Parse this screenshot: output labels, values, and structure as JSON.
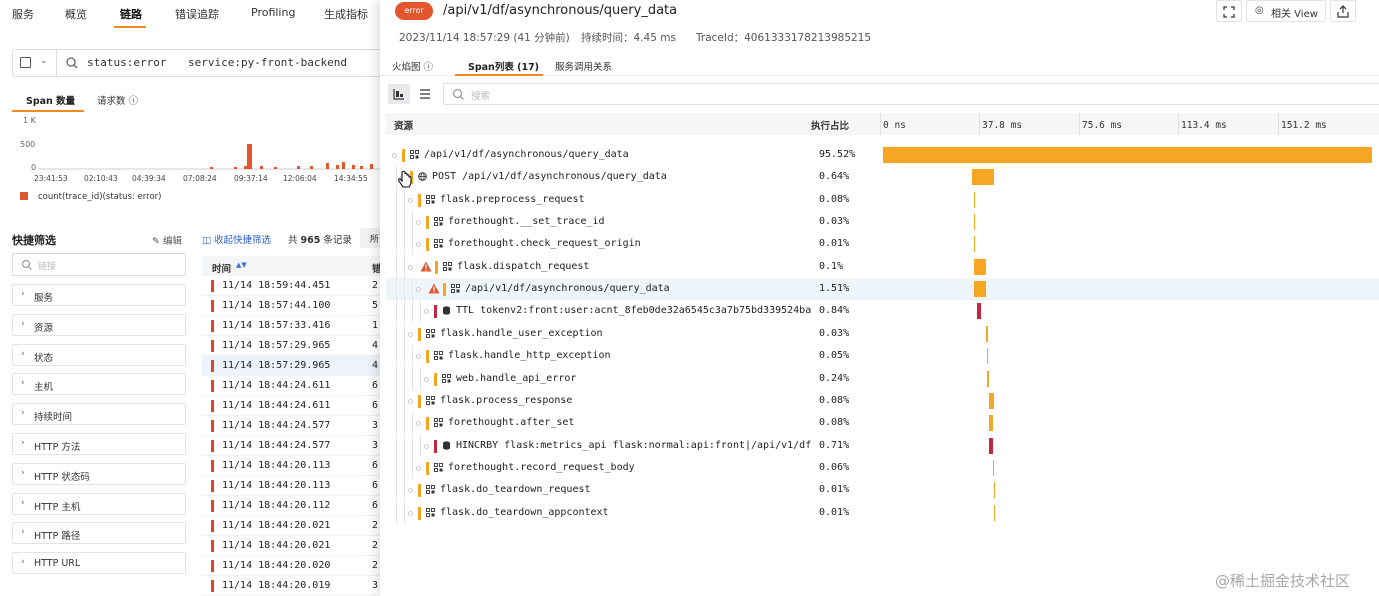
{
  "colors": {
    "accent": "#f08a24",
    "error": "#e4572e",
    "span_bar": "#f5a623",
    "db_bar": "#c0283e",
    "link": "#2f62c8"
  },
  "topnav": {
    "tabs": [
      "服务",
      "概览",
      "链路",
      "错误追踪",
      "Profiling",
      "生成指标"
    ],
    "active": "链路"
  },
  "search": {
    "tokens": [
      {
        "key": "status",
        "value": "error"
      },
      {
        "key": "service",
        "value": "py-front-backend"
      }
    ]
  },
  "chart_tabs": [
    "Span 数量",
    "请求数"
  ],
  "mini_chart": {
    "type": "bar",
    "y_ticks": [
      "1 K",
      "500",
      "0"
    ],
    "x_ticks": [
      "23:41:53",
      "02:10:43",
      "04:39:34",
      "07:08:24",
      "09:37:14",
      "12:06:04",
      "14:34:55"
    ],
    "legend": "count(trace_id)(status: error)"
  },
  "quick_filter": {
    "title": "快捷筛选",
    "edit_label": "编辑",
    "search_placeholder": "链接",
    "items": [
      "服务",
      "资源",
      "状态",
      "主机",
      "持续时间",
      "HTTP 方法",
      "HTTP 状态码",
      "HTTP 主机",
      "HTTP 路径",
      "HTTP URL"
    ]
  },
  "list_toolbar": {
    "collapse_label": "收起快捷筛选",
    "count_prefix": "共",
    "count": "965",
    "count_suffix": "条记录",
    "stub": "所"
  },
  "table": {
    "headers": [
      "时间",
      "错"
    ],
    "rows": [
      {
        "time": "11/14 18:59:44.451",
        "c": "2"
      },
      {
        "time": "11/14 18:57:44.100",
        "c": "5"
      },
      {
        "time": "11/14 18:57:33.416",
        "c": "1"
      },
      {
        "time": "11/14 18:57:29.965",
        "c": "4"
      },
      {
        "time": "11/14 18:57:29.965",
        "c": "4"
      },
      {
        "time": "11/14 18:44:24.611",
        "c": "6"
      },
      {
        "time": "11/14 18:44:24.611",
        "c": "6"
      },
      {
        "time": "11/14 18:44:24.577",
        "c": "3"
      },
      {
        "time": "11/14 18:44:24.577",
        "c": "3"
      },
      {
        "time": "11/14 18:44:20.113",
        "c": "6"
      },
      {
        "time": "11/14 18:44:20.113",
        "c": "6"
      },
      {
        "time": "11/14 18:44:20.112",
        "c": "6"
      },
      {
        "time": "11/14 18:44:20.021",
        "c": "2"
      },
      {
        "time": "11/14 18:44:20.021",
        "c": "2"
      },
      {
        "time": "11/14 18:44:20.020",
        "c": "2"
      },
      {
        "time": "11/14 18:44:20.019",
        "c": "3"
      }
    ],
    "selected_index": 4
  },
  "drawer": {
    "status_badge": "error",
    "title": "/api/v1/df/asynchronous/query_data",
    "timestamp": "2023/11/14 18:57:29 (41 分钟前)",
    "duration": "持续时间：4.45 ms",
    "trace_id": "TraceId：4061333178213985215",
    "related_view": "相关 View",
    "tabs": [
      "火焰图",
      "Span列表 (17)",
      "服务调用关系"
    ],
    "active_tab": "Span列表 (17)",
    "search_placeholder": "搜索",
    "columns": {
      "resource": "资源",
      "percent": "执行占比"
    },
    "timeline_ticks": [
      "0 ns",
      "37.8 ms",
      "75.6 ms",
      "113.4 ms",
      "151.2 ms"
    ]
  },
  "spans": [
    {
      "name": "/api/v1/df/asynchronous/query_data",
      "percent": "95.52%",
      "depth": 0,
      "kind": "web",
      "error": false
    },
    {
      "name": "POST /api/v1/df/asynchronous/query_data",
      "percent": "0.64%",
      "depth": 1,
      "kind": "http",
      "error": false
    },
    {
      "name": "flask.preprocess_request",
      "percent": "0.08%",
      "depth": 2,
      "kind": "web",
      "error": false
    },
    {
      "name": "forethought.__set_trace_id",
      "percent": "0.03%",
      "depth": 3,
      "kind": "web",
      "error": false
    },
    {
      "name": "forethought.check_request_origin",
      "percent": "0.01%",
      "depth": 3,
      "kind": "web",
      "error": false
    },
    {
      "name": "flask.dispatch_request",
      "percent": "0.1%",
      "depth": 2,
      "kind": "web",
      "error": true
    },
    {
      "name": "/api/v1/df/asynchronous/query_data",
      "percent": "1.51%",
      "depth": 3,
      "kind": "web",
      "error": true
    },
    {
      "name": "TTL tokenv2:front:user:acnt_8feb0de32a6545c3a7b75bd339524bad:…",
      "percent": "0.84%",
      "depth": 4,
      "kind": "db",
      "error": false
    },
    {
      "name": "flask.handle_user_exception",
      "percent": "0.03%",
      "depth": 2,
      "kind": "web",
      "error": false
    },
    {
      "name": "flask.handle_http_exception",
      "percent": "0.05%",
      "depth": 3,
      "kind": "web",
      "error": false
    },
    {
      "name": "web.handle_api_error",
      "percent": "0.24%",
      "depth": 4,
      "kind": "web",
      "error": false
    },
    {
      "name": "flask.process_response",
      "percent": "0.08%",
      "depth": 2,
      "kind": "web",
      "error": false
    },
    {
      "name": "forethought.after_set",
      "percent": "0.08%",
      "depth": 3,
      "kind": "web",
      "error": false
    },
    {
      "name": "HINCRBY flask:metrics_api flask:normal:api:front|/api/v1/df/a…",
      "percent": "0.71%",
      "depth": 4,
      "kind": "db",
      "error": false
    },
    {
      "name": "forethought.record_request_body",
      "percent": "0.06%",
      "depth": 3,
      "kind": "web",
      "error": false
    },
    {
      "name": "flask.do_teardown_request",
      "percent": "0.01%",
      "depth": 2,
      "kind": "web",
      "error": false
    },
    {
      "name": "flask.do_teardown_appcontext",
      "percent": "0.01%",
      "depth": 2,
      "kind": "web",
      "error": false
    }
  ],
  "highlighted_span": 6,
  "watermark": "@稀土掘金技术社区"
}
